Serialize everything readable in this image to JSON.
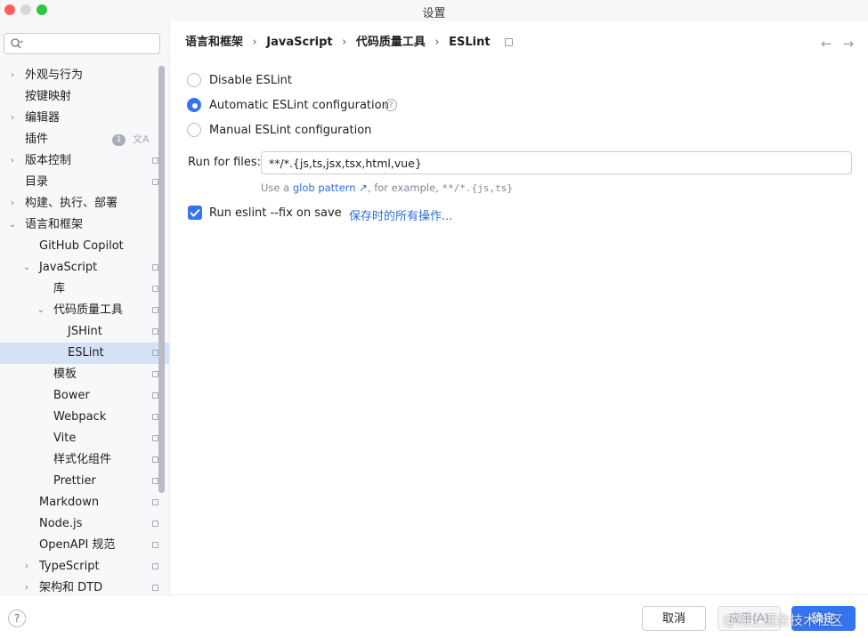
{
  "window": {
    "title": "设置"
  },
  "search": {
    "placeholder": ""
  },
  "sidebar": {
    "items": [
      {
        "label": "外观与行为",
        "chevron": "›"
      },
      {
        "label": "按键映射",
        "chevron": ""
      },
      {
        "label": "编辑器",
        "chevron": "›"
      },
      {
        "label": "插件",
        "chevron": "",
        "badge": "1"
      },
      {
        "label": "版本控制",
        "chevron": "›"
      },
      {
        "label": "目录",
        "chevron": ""
      },
      {
        "label": "构建、执行、部署",
        "chevron": "›"
      },
      {
        "label": "语言和框架",
        "chevron": "⌄"
      },
      {
        "label": "GitHub Copilot",
        "chevron": ""
      },
      {
        "label": "JavaScript",
        "chevron": "⌄"
      },
      {
        "label": "库",
        "chevron": ""
      },
      {
        "label": "代码质量工具",
        "chevron": "⌄"
      },
      {
        "label": "JSHint",
        "chevron": ""
      },
      {
        "label": "ESLint",
        "chevron": ""
      },
      {
        "label": "模板",
        "chevron": ""
      },
      {
        "label": "Bower",
        "chevron": ""
      },
      {
        "label": "Webpack",
        "chevron": ""
      },
      {
        "label": "Vite",
        "chevron": ""
      },
      {
        "label": "样式化组件",
        "chevron": ""
      },
      {
        "label": "Prettier",
        "chevron": ""
      },
      {
        "label": "Markdown",
        "chevron": ""
      },
      {
        "label": "Node.js",
        "chevron": ""
      },
      {
        "label": "OpenAPI 规范",
        "chevron": ""
      },
      {
        "label": "TypeScript",
        "chevron": "›"
      },
      {
        "label": "架构和 DTD",
        "chevron": "›"
      }
    ],
    "lang_icon": "文A"
  },
  "breadcrumb": [
    "语言和框架",
    "JavaScript",
    "代码质量工具",
    "ESLint"
  ],
  "breadcrumb_sep": "›",
  "nav": {
    "back": "←",
    "forward": "→"
  },
  "eslint": {
    "options": [
      {
        "label": "Disable ESLint",
        "selected": false
      },
      {
        "label": "Automatic ESLint configuration",
        "selected": true
      },
      {
        "label": "Manual ESLint configuration",
        "selected": false
      }
    ],
    "help_glyph": "?",
    "run_for_files_label": "Run for files:",
    "run_for_files_value": "**/*.{js,ts,jsx,tsx,html,vue}",
    "hint_prefix": "Use a",
    "hint_link": "glob pattern ↗",
    "hint_middle": ", for example,",
    "hint_example": "**/*.{js,ts}",
    "fix_on_save_label": "Run eslint --fix on save",
    "fix_on_save_checked": true,
    "save_actions_link": "保存时的所有操作..."
  },
  "footer": {
    "help": "?",
    "cancel": "取消",
    "apply": "应用(A)",
    "ok": "确定"
  },
  "watermark": "@稀土掘金技术社区",
  "colors": {
    "accent": "#3574f0",
    "selected_row": "#d5e1f7",
    "link": "#2b6fd6"
  }
}
